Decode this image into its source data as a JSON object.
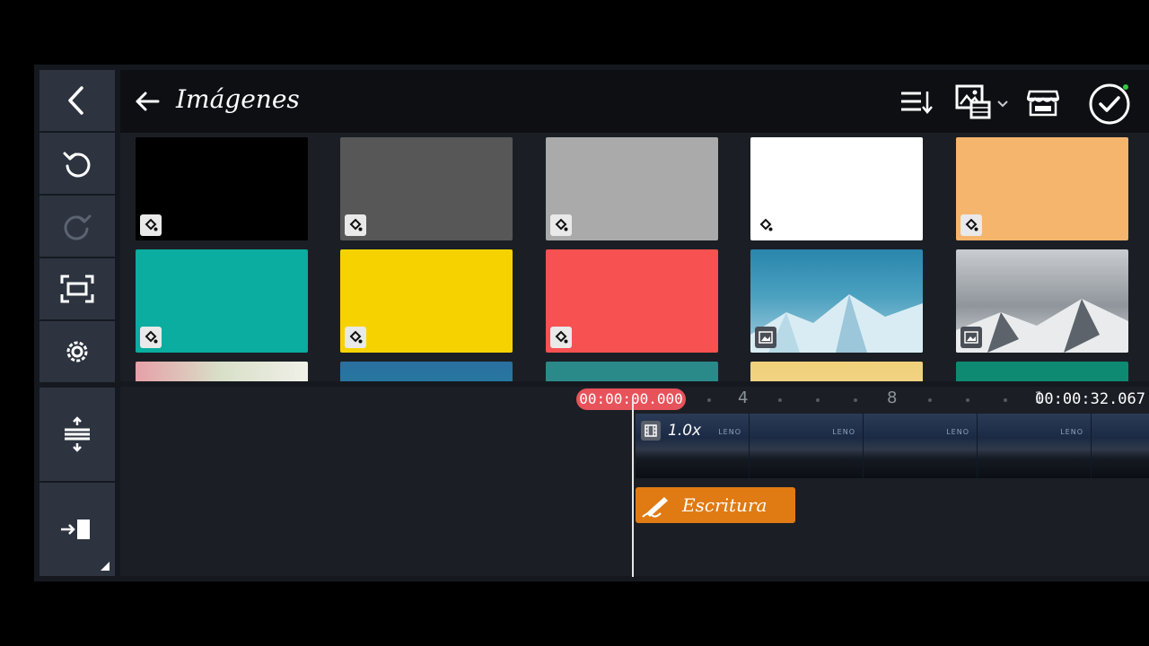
{
  "panel": {
    "title": "Imágenes",
    "icons": [
      "back-arrow-icon",
      "sort-icon",
      "media-type-icon",
      "chevron-down-icon",
      "asset-store-icon",
      "done-check-icon"
    ]
  },
  "rail": {
    "icons": [
      "chevron-left-icon",
      "undo-icon",
      "redo-icon",
      "fullscreen-icon",
      "settings-icon",
      "timeline-expand-icon",
      "move-to-end-icon"
    ]
  },
  "tiles": [
    {
      "type": "color",
      "color": "#000000"
    },
    {
      "type": "color",
      "color": "#575757"
    },
    {
      "type": "color",
      "color": "#aaaaaa"
    },
    {
      "type": "color",
      "color": "#ffffff"
    },
    {
      "type": "color",
      "color": "#f5b56c"
    },
    {
      "type": "color",
      "color": "#0aada0"
    },
    {
      "type": "color",
      "color": "#f6d300"
    },
    {
      "type": "color",
      "color": "#f75151"
    },
    {
      "type": "image",
      "description_colors": [
        "#2c8ab0",
        "#b5d3e3"
      ]
    },
    {
      "type": "image",
      "description_colors": [
        "#9aa0a6",
        "#d8dadc"
      ]
    }
  ],
  "timeline": {
    "current_time": "00:00:00.000",
    "total_time": "00:00:32.067",
    "ruler_labels": [
      "4",
      "8",
      "1"
    ],
    "clip_speed": "1.0x",
    "clip_watermark": "LENO",
    "handwriting_label": "Escritura"
  },
  "colors": {
    "accent_red": "#e8525a",
    "handwriting_orange": "#e07a12",
    "rail_button": "#2d3440"
  }
}
